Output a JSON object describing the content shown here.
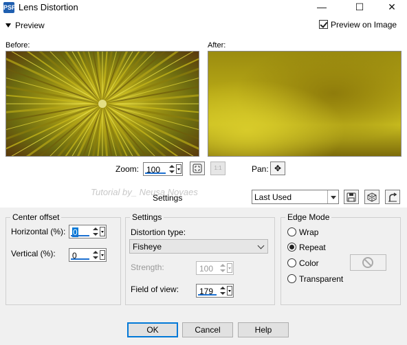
{
  "window": {
    "title": "Lens Distortion",
    "app_icon": "PSP"
  },
  "preview": {
    "toggle_label": "Preview",
    "preview_on_image_label": "Preview on Image",
    "preview_on_image_checked": true,
    "before_label": "Before:",
    "after_label": "After:"
  },
  "zoom": {
    "label": "Zoom:",
    "value": "100"
  },
  "pan": {
    "label": "Pan:"
  },
  "watermark": "Tutorial by_ Neusa Novaes",
  "settings_band": {
    "title": "Settings",
    "preset_value": "Last Used"
  },
  "center_offset": {
    "legend": "Center offset",
    "horizontal_label": "Horizontal (%):",
    "horizontal_value": "0",
    "vertical_label": "Vertical (%):",
    "vertical_value": "0"
  },
  "settings": {
    "legend": "Settings",
    "distortion_type_label": "Distortion type:",
    "distortion_type_value": "Fisheye",
    "strength_label": "Strength:",
    "strength_value": "100",
    "field_of_view_label": "Field of view:",
    "field_of_view_value": "179"
  },
  "edge_mode": {
    "legend": "Edge Mode",
    "options": [
      "Wrap",
      "Repeat",
      "Color",
      "Transparent"
    ],
    "selected": "Repeat"
  },
  "buttons": {
    "ok": "OK",
    "cancel": "Cancel",
    "help": "Help"
  },
  "colors": {
    "accent": "#0078d7",
    "panel": "#f0f0f0",
    "preview_gold": "#c9bd1f"
  }
}
